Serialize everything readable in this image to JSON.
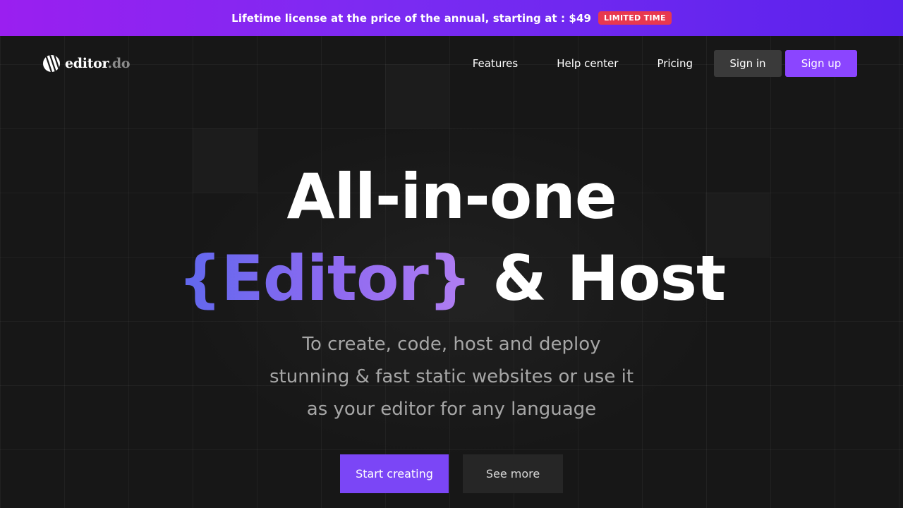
{
  "promo": {
    "text": "Lifetime license at the price of the annual, starting at : $49",
    "badge": "LIMITED TIME"
  },
  "logo": {
    "name": "editor",
    "tld": ".do",
    "icon": "logo-stripes-icon"
  },
  "nav": {
    "links": [
      "Features",
      "Help center",
      "Pricing"
    ],
    "signin_label": "Sign in",
    "signup_label": "Sign up"
  },
  "hero": {
    "line1": "All-in-one",
    "accent": "{Editor}",
    "line2_rest": " & Host",
    "subtitle": [
      "To create, code, host and deploy",
      "stunning & fast static websites or use it",
      "as your editor for any language"
    ],
    "primary_cta": "Start creating",
    "secondary_cta": "See more"
  },
  "colors": {
    "brand_purple": "#8b45ff",
    "badge_red": "#e8384f",
    "background": "#171717"
  }
}
